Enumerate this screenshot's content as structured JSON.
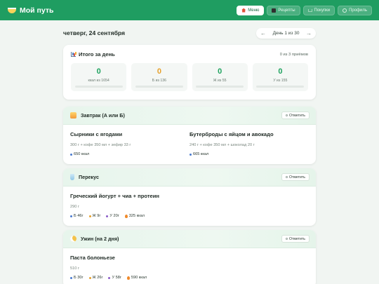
{
  "header": {
    "title": "Мой путь",
    "nav": [
      "Меню",
      "Рецепты",
      "Покупки",
      "Профиль"
    ]
  },
  "day": {
    "date": "четверг, 24 сентября",
    "counter": "День 1 из 30"
  },
  "summary": {
    "title": "Итого за день",
    "meals_count": "0 из 3 приёмов",
    "stats": [
      {
        "value": "0",
        "label": "ккал из 1654",
        "color": "#1fa35f"
      },
      {
        "value": "0",
        "label": "Б из 136",
        "color": "#e6a12c"
      },
      {
        "value": "0",
        "label": "Ж из 55",
        "color": "#1fa35f"
      },
      {
        "value": "0",
        "label": "У из 155",
        "color": "#1fa35f"
      }
    ]
  },
  "mark_label": "Отметить",
  "meals": [
    {
      "title": "Завтрак (А или Б)",
      "dishes": [
        {
          "name": "Сырники с ягодами",
          "desc": "300 г + кофе 350 мл + зефир 33 г",
          "kcal": "650 ккал"
        },
        {
          "name": "Бутерброды с яйцом и авокадо",
          "desc": "240 г + кофе 350 мл + шоколад 20 г",
          "kcal": "665 ккал"
        }
      ]
    },
    {
      "title": "Перекус",
      "dish": {
        "name": "Греческий йогурт + чиа + протеин",
        "desc": "290 г",
        "p": "Б 46г",
        "f": "Ж 9г",
        "c": "У 20г",
        "kcal": "325 ккал"
      }
    },
    {
      "title": "Ужин (на 2 дня)",
      "dish": {
        "name": "Паста болоньезе",
        "desc": "510 г",
        "p": "Б 30г",
        "f": "Ж 26г",
        "c": "У 58г",
        "kcal": "590 ккал"
      }
    }
  ],
  "colors": {
    "brand": "#1f9d61",
    "protein": "#4a7bd0",
    "fat": "#e6a12c",
    "carb": "#8a5cc8",
    "kcal": "#4a7bd0"
  }
}
